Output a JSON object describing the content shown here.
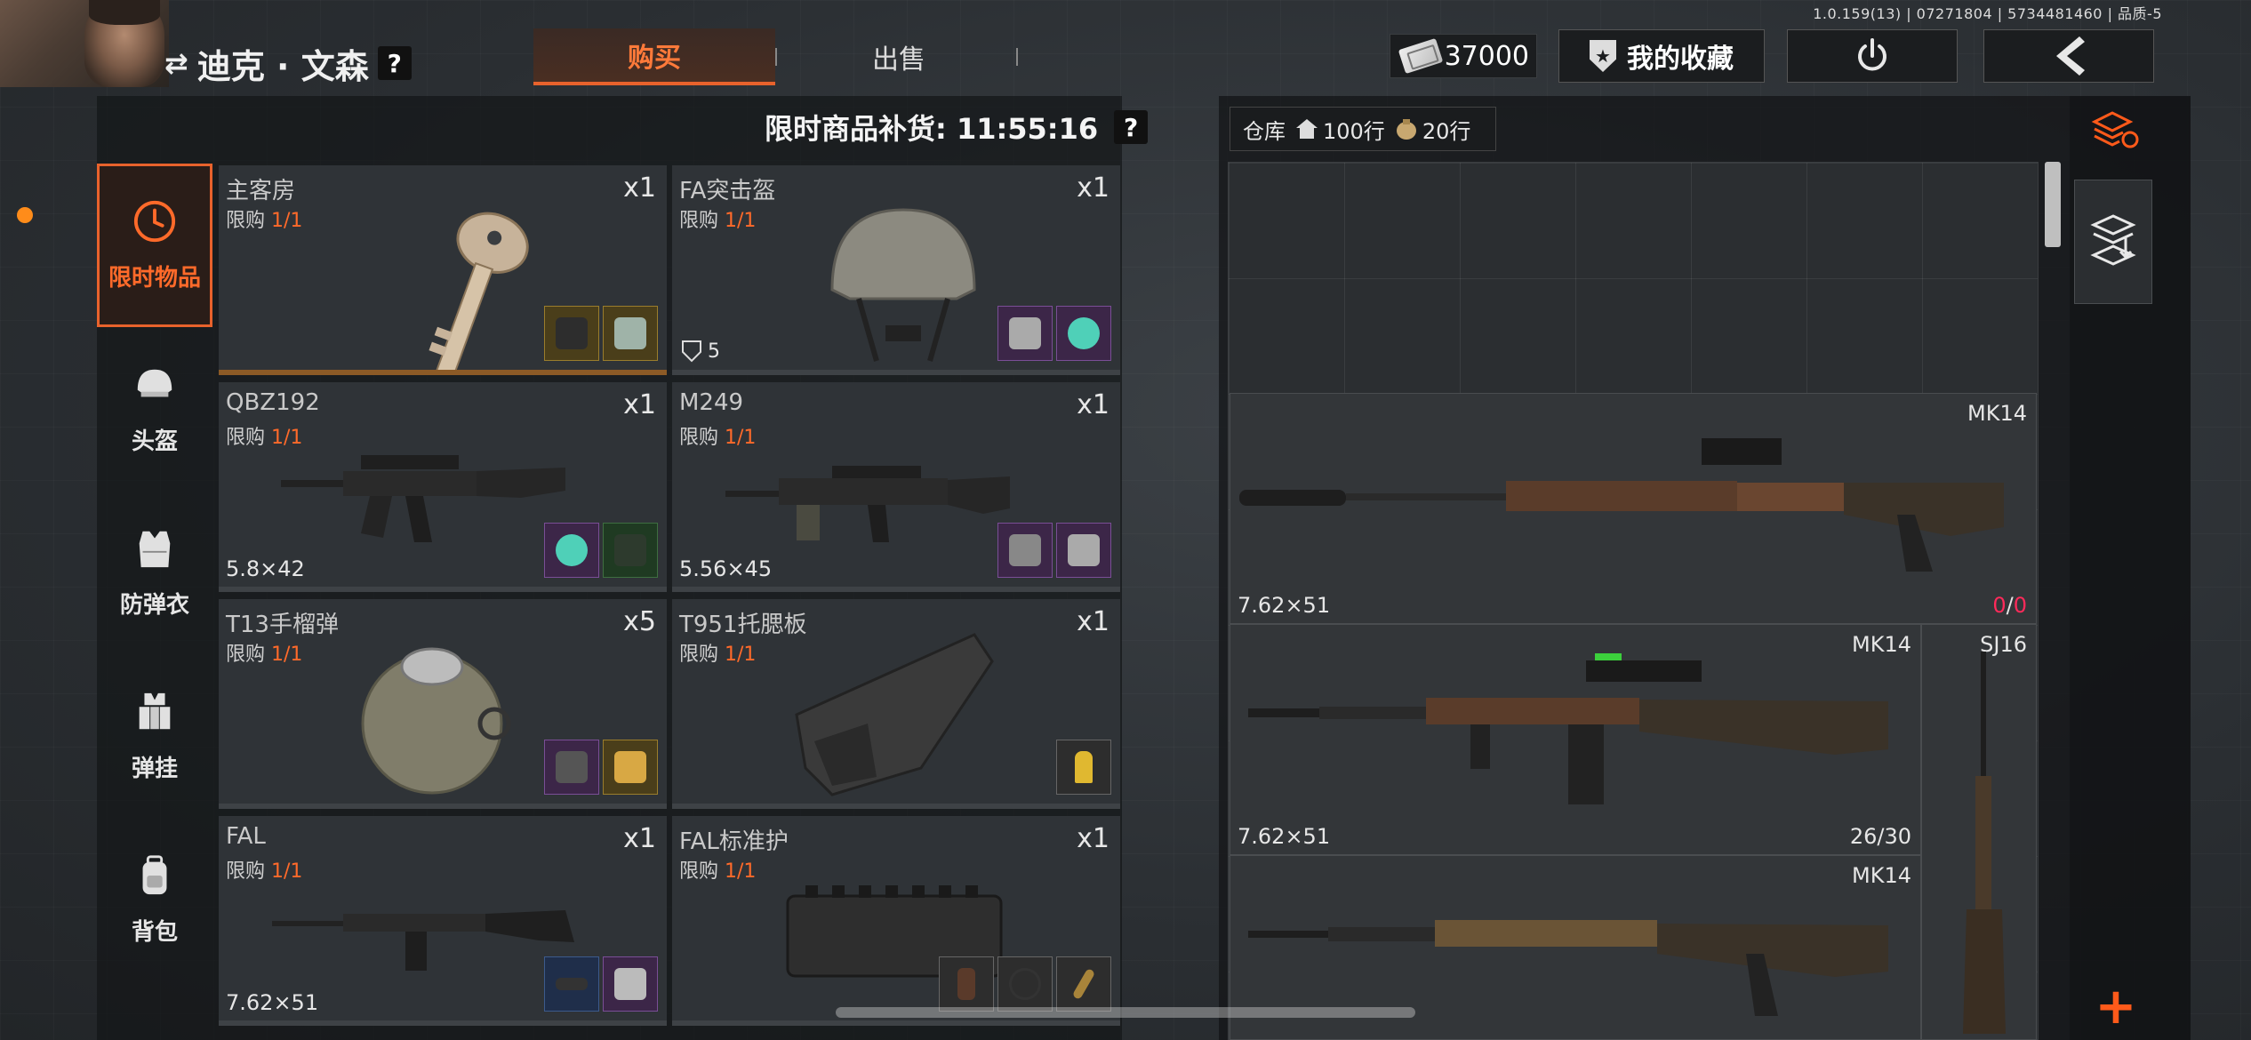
{
  "version": "1.0.159(13) | 07271804 | 5734481460 | 品质-5",
  "trader": {
    "name": "迪克 · 文森",
    "help": "?"
  },
  "tabs": {
    "buy": "购买",
    "sell": "出售"
  },
  "money": "37000",
  "favorites": "我的收藏",
  "restock": {
    "label": "限时商品补货: 11:55:16",
    "help": "?"
  },
  "categories": [
    {
      "label": "限时物品",
      "icon": "clock-icon"
    },
    {
      "label": "头盔",
      "icon": "helmet-icon"
    },
    {
      "label": "防弹衣",
      "icon": "vest-icon"
    },
    {
      "label": "弹挂",
      "icon": "chest-rig-icon"
    },
    {
      "label": "背包",
      "icon": "backpack-icon"
    }
  ],
  "items": [
    {
      "name": "主客房",
      "limit_label": "限购",
      "limit": "1/1",
      "qty": "x1",
      "extra": "",
      "art": "key"
    },
    {
      "name": "FA突击盔",
      "limit_label": "限购",
      "limit": "1/1",
      "qty": "x1",
      "extra": "5",
      "art": "helmet"
    },
    {
      "name": "QBZ192",
      "limit_label": "限购",
      "limit": "1/1",
      "qty": "x1",
      "extra": "5.8×42",
      "art": "rifle"
    },
    {
      "name": "M249",
      "limit_label": "限购",
      "limit": "1/1",
      "qty": "x1",
      "extra": "5.56×45",
      "art": "lmg"
    },
    {
      "name": "T13手榴弹",
      "limit_label": "限购",
      "limit": "1/1",
      "qty": "x5",
      "extra": "",
      "art": "grenade"
    },
    {
      "name": "T951托腮板",
      "limit_label": "限购",
      "limit": "1/1",
      "qty": "x1",
      "extra": "",
      "art": "cheekrest"
    },
    {
      "name": "FAL",
      "limit_label": "限购",
      "limit": "1/1",
      "qty": "x1",
      "extra": "7.62×51",
      "art": "fal"
    },
    {
      "name": "FAL标准护",
      "limit_label": "限购",
      "limit": "1/1",
      "qty": "x1",
      "extra": "",
      "art": "handguard"
    }
  ],
  "warehouse": {
    "label": "仓库",
    "home_rows": "100行",
    "bag_rows": "20行",
    "items": [
      {
        "name": "MK14",
        "caliber": "7.62×51",
        "ammo_cur": "0",
        "ammo_max": "0"
      },
      {
        "name": "MK14",
        "caliber": "7.62×51",
        "ammo": "26/30"
      },
      {
        "name": "SJ16"
      },
      {
        "name": "MK14"
      }
    ]
  },
  "colors": {
    "accent": "#e8622c",
    "limit": "#ff6a2a",
    "ammo_empty": "#ff2a5a"
  }
}
